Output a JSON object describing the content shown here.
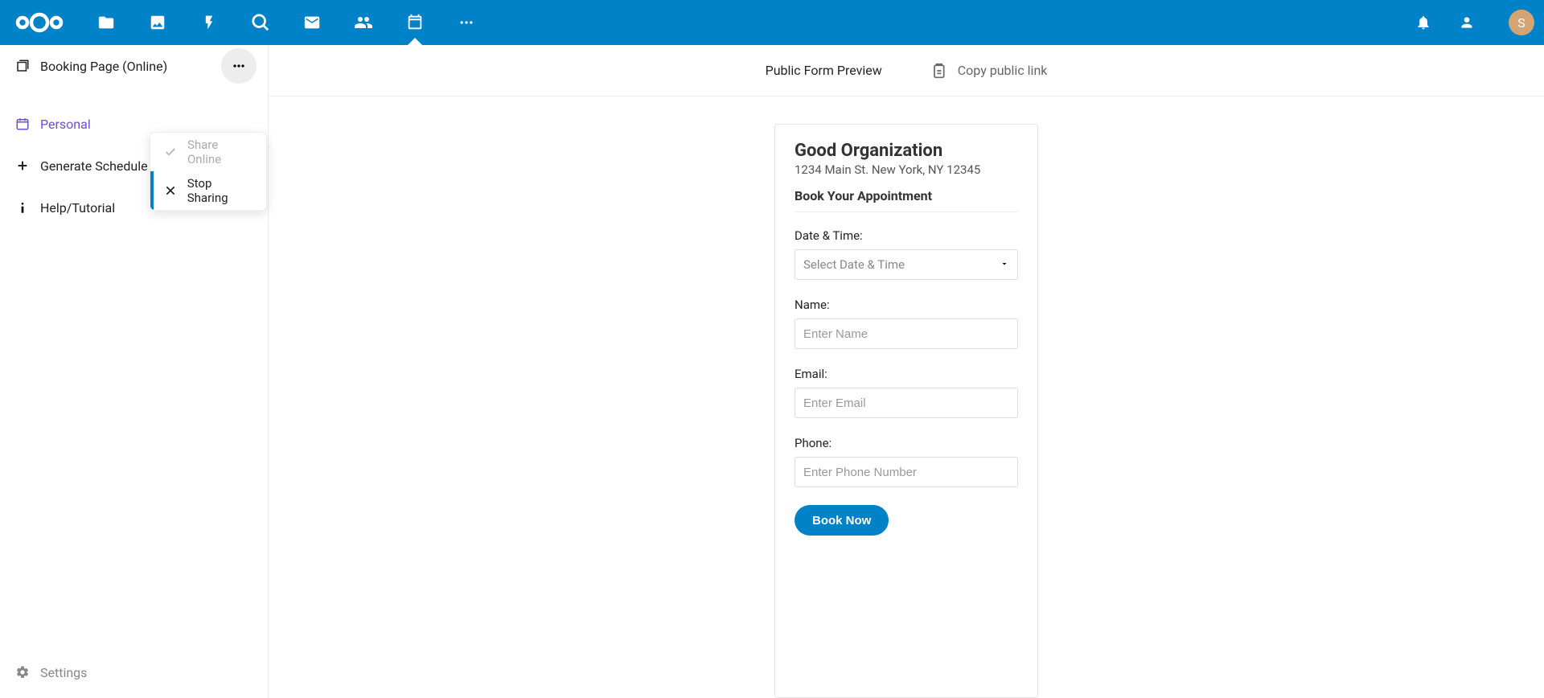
{
  "topbar": {
    "avatar_initial": "S"
  },
  "sidebar": {
    "booking_page": "Booking Page (Online)",
    "personal": "Personal",
    "generate_schedule": "Generate Schedule",
    "help_tutorial": "Help/Tutorial",
    "settings": "Settings"
  },
  "dropdown": {
    "share_online": "Share Online",
    "stop_sharing": "Stop Sharing"
  },
  "content_header": {
    "preview_title": "Public Form Preview",
    "copy_link": "Copy public link"
  },
  "form": {
    "org_name": "Good Organization",
    "org_address": "1234 Main St. New York, NY 12345",
    "sub_heading": "Book Your Appointment",
    "date_time_label": "Date & Time:",
    "date_time_placeholder": "Select Date & Time",
    "name_label": "Name:",
    "name_placeholder": "Enter Name",
    "email_label": "Email:",
    "email_placeholder": "Enter Email",
    "phone_label": "Phone:",
    "phone_placeholder": "Enter Phone Number",
    "book_button": "Book Now"
  }
}
